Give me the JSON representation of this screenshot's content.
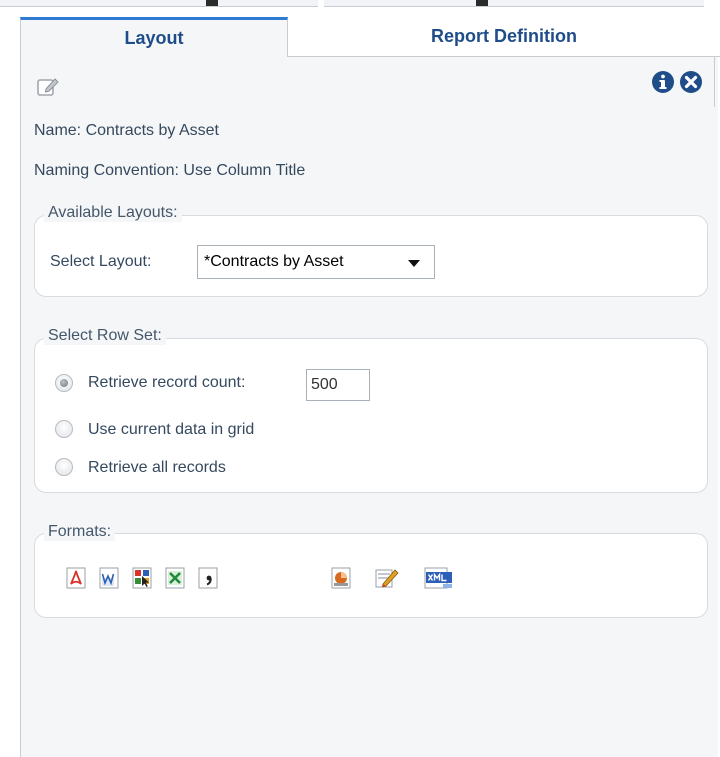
{
  "tabs": [
    {
      "label": "Layout",
      "active": true
    },
    {
      "label": "Report Definition",
      "active": false
    }
  ],
  "toolbar": {
    "edit_icon": "edit-icon",
    "info_icon": "info-icon",
    "close_icon": "close-icon"
  },
  "details": {
    "name": "Name: Contracts by Asset",
    "naming_convention": "Naming Convention: Use Column Title"
  },
  "available_layouts": {
    "legend": "Available Layouts:",
    "select_label": "Select Layout:",
    "selected": "*Contracts by Asset"
  },
  "row_set": {
    "legend": "Select Row Set:",
    "options": [
      {
        "label": "Retrieve record count:",
        "checked": true
      },
      {
        "label": "Use current data in grid",
        "checked": false
      },
      {
        "label": "Retrieve all records",
        "checked": false
      }
    ],
    "record_count": "500"
  },
  "formats": {
    "legend": "Formats:",
    "items": [
      {
        "icon": "pdf-icon",
        "color": "#d9342b"
      },
      {
        "icon": "word-icon",
        "color": "#2b5fb8"
      },
      {
        "icon": "grid-report-icon",
        "color": "#3a8a3a"
      },
      {
        "icon": "excel-icon",
        "color": "#1f8a3a"
      },
      {
        "icon": "csv-icon",
        "color": "#333333"
      },
      {
        "icon": "powerpoint-icon",
        "color": "#d86a1d"
      },
      {
        "icon": "edit-report-icon",
        "color": "#e0a020"
      },
      {
        "icon": "xml-icon",
        "color": "#2b5fb8"
      }
    ]
  },
  "colors": {
    "accent": "#2f7bd2",
    "tab_text": "#1f4d8a",
    "icon_blue": "#1f4d8a"
  }
}
